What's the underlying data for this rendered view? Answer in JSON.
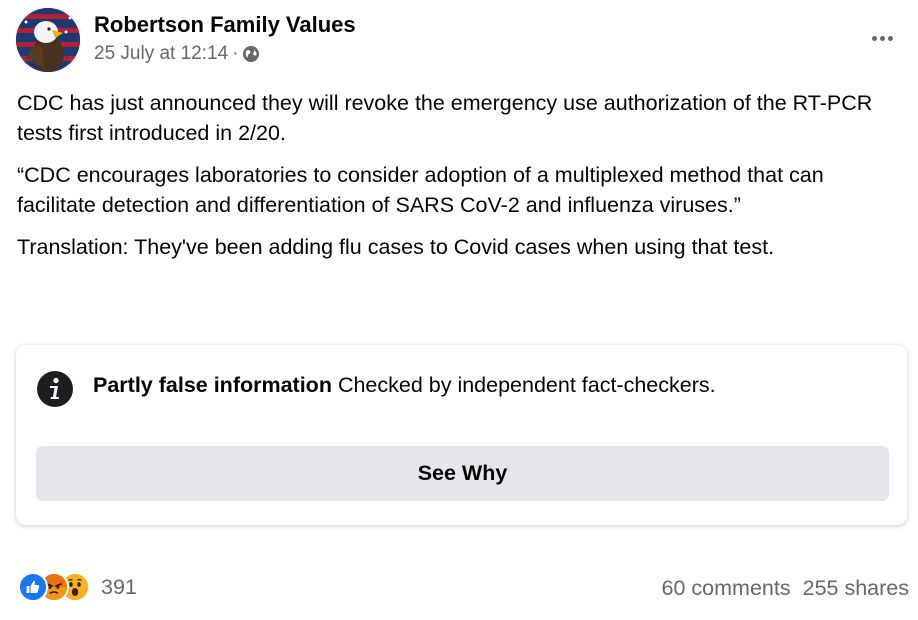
{
  "post": {
    "author": "Robertson Family Values",
    "timestamp": "25 July at 12:14",
    "separator": "·",
    "privacy_icon": "globe-icon",
    "more_icon": "more-options-icon",
    "paragraphs": [
      "CDC has just announced they will revoke the emergency use authorization of the RT-PCR tests first introduced in 2/20.",
      "“CDC encourages laboratories to consider adoption of a multiplexed method that can facilitate detection and differentiation of SARS CoV-2 and influenza viruses.”",
      "Translation: They've been adding flu cases to Covid cases when using that test."
    ]
  },
  "fact_check": {
    "icon": "info-icon",
    "title": "Partly false information",
    "description": "Checked by independent fact-checkers.",
    "button_label": "See Why"
  },
  "engagement": {
    "reactions": [
      "like",
      "angry",
      "wow"
    ],
    "reaction_count": "391",
    "comments": "60 comments",
    "shares": "255 shares"
  },
  "colors": {
    "like_blue": "#1877f2",
    "angry_orange": "#e9710f",
    "wow_yellow": "#f7b125",
    "secondary_text": "#65676b",
    "button_bg": "#e4e6eb"
  }
}
